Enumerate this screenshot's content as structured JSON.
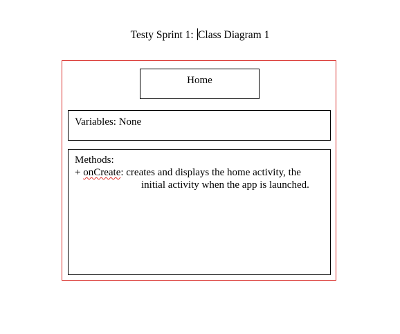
{
  "document": {
    "title_before_cursor": "Testy Sprint 1: ",
    "title_after_cursor": "Class Diagram 1"
  },
  "class_diagram": {
    "class_name": "Home",
    "variables": "Variables: None",
    "methods_header": "Methods:",
    "method": {
      "prefix": "+ ",
      "name": "onCreate",
      "description_line1": ": creates and displays the home activity, the",
      "description_line2": "initial activity when the app is launched."
    }
  },
  "colors": {
    "frame_border": "#d9302c",
    "box_border": "#000000",
    "spellcheck_underline": "#e0302a"
  }
}
